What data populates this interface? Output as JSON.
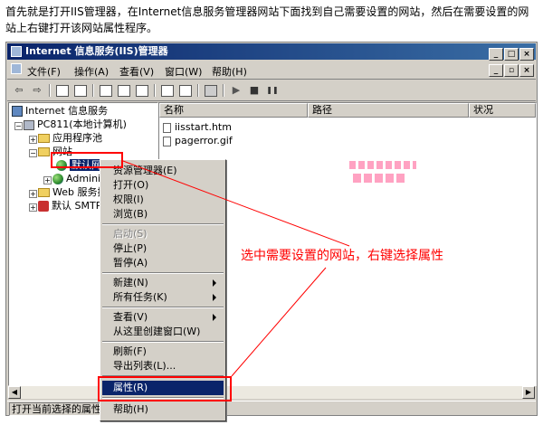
{
  "intro_text": "首先就是打开IIS管理器，在Internet信息服务管理器网站下面找到自己需要设置的网站，然后在需要设置的网站上右键打开该网站属性程序。",
  "window": {
    "title": "Internet 信息服务(IIS)管理器",
    "buttons": {
      "minimize": "_",
      "maximize": "□",
      "close": "×"
    },
    "mdi_buttons": {
      "minimize": "_",
      "restore": "▫",
      "close": "×"
    }
  },
  "menubar": {
    "items": [
      "文件(F)",
      "操作(A)",
      "查看(V)",
      "窗口(W)",
      "帮助(H)"
    ]
  },
  "toolbar": {
    "icons": [
      "back-arrow-icon",
      "forward-arrow-icon",
      "up-folder-icon",
      "show-tree-icon",
      "properties-icon",
      "refresh-icon",
      "export-icon",
      "help-icon",
      "console-icon",
      "computer-icon",
      "play-icon",
      "stop-icon",
      "pause-icon"
    ],
    "glyphs": {
      "back": "⇦",
      "forward": "⇨",
      "play": "▶",
      "stop": "■",
      "pause": "❚❚"
    }
  },
  "tree": {
    "root": "Internet 信息服务",
    "computer": "PC811(本地计算机)",
    "app_pools": "应用程序池",
    "websites": "网站",
    "default_site": "默认网站",
    "admin_site": "Administ",
    "web_ext": "Web 服务扩",
    "smtp": "默认 SMTP 虚"
  },
  "list": {
    "columns": [
      "名称",
      "路径",
      "状况"
    ],
    "files": [
      "iisstart.htm",
      "pagerror.gif"
    ]
  },
  "context_menu": {
    "items": [
      {
        "label": "资源管理器(E)",
        "disabled": false
      },
      {
        "label": "打开(O)",
        "disabled": false
      },
      {
        "label": "权限(I)",
        "disabled": false
      },
      {
        "label": "浏览(B)",
        "disabled": false
      },
      {
        "label": "启动(S)",
        "disabled": true
      },
      {
        "label": "停止(P)",
        "disabled": false
      },
      {
        "label": "暂停(A)",
        "disabled": false
      },
      {
        "label": "新建(N)",
        "disabled": false,
        "submenu": true
      },
      {
        "label": "所有任务(K)",
        "disabled": false,
        "submenu": true
      },
      {
        "label": "查看(V)",
        "disabled": false,
        "submenu": true
      },
      {
        "label": "从这里创建窗口(W)",
        "disabled": false
      },
      {
        "label": "刷新(F)",
        "disabled": false
      },
      {
        "label": "导出列表(L)...",
        "disabled": false
      },
      {
        "label": "属性(R)",
        "disabled": false,
        "selected": true
      },
      {
        "label": "帮助(H)",
        "disabled": false
      }
    ]
  },
  "statusbar": {
    "text": "打开当前选择的属性对"
  },
  "annotation": {
    "text": "选中需要设置的网站，右键选择属性",
    "color": "#ff0000"
  },
  "colors": {
    "titlebar": "#0a246a",
    "selection": "#0a246a",
    "annotation": "#ff0000"
  }
}
